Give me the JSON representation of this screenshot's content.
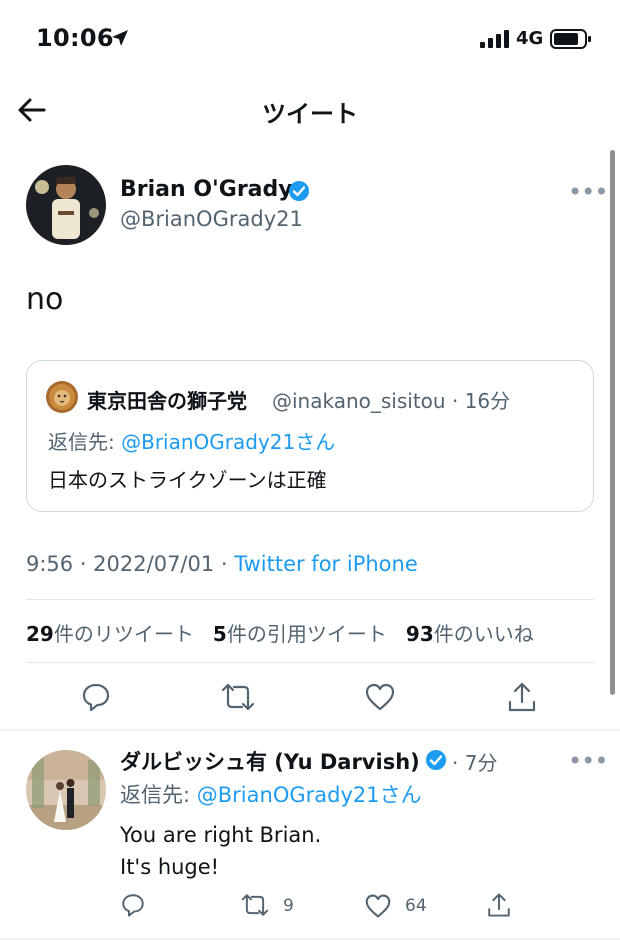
{
  "status_bar": {
    "time": "10:06",
    "network": "4G"
  },
  "nav": {
    "title": "ツイート"
  },
  "tweet": {
    "author_name": "Brian O'Grady",
    "author_handle": "@BrianOGrady21",
    "text": "no",
    "quote": {
      "author_name": "東京田舎の獅子党",
      "author_handle_time": "@inakano_sisitou · 16分",
      "reply_prefix": "返信先: ",
      "reply_handle": "@BrianOGrady21さん",
      "text": "日本のストライクゾーンは正確"
    },
    "meta_datetime": "9:56 · 2022/07/01 · ",
    "meta_source": "Twitter for iPhone",
    "stats": {
      "retweets_count": "29",
      "retweets_label": "件のリツイート",
      "quotes_count": "5",
      "quotes_label": "件の引用ツイート",
      "likes_count": "93",
      "likes_label": "件のいいね"
    }
  },
  "reply": {
    "author_name": "ダルビッシュ有 (Yu Darvish)",
    "time": "· 7分",
    "reply_prefix": "返信先: ",
    "reply_handle": "@BrianOGrady21さん",
    "text_line1": "You are right Brian.",
    "text_line2": "It's huge!",
    "retweet_count": "9",
    "like_count": "64"
  },
  "colors": {
    "accent": "#1d9bf0",
    "secondary_text": "#536471",
    "verified": "#1d9bf0"
  }
}
